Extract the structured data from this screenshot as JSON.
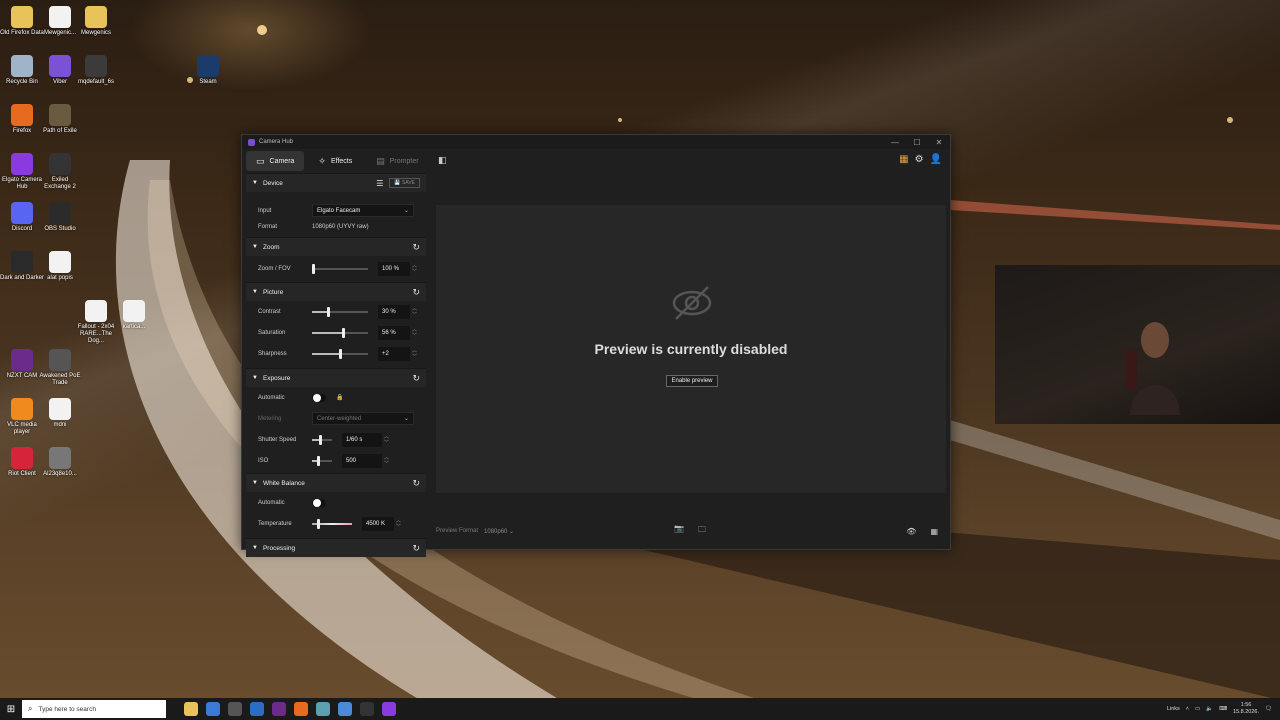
{
  "desktop": {
    "icons": [
      {
        "label": "Old Firefox Data",
        "color": "#e8c35a"
      },
      {
        "label": "Mewgenic...",
        "color": "#f2f2f2"
      },
      {
        "label": "Mewgenics",
        "color": "#e8c35a"
      },
      {
        "label": "Recycle Bin",
        "color": "#9fb4c8"
      },
      {
        "label": "Viber",
        "color": "#7b52d6"
      },
      {
        "label": "mqdefault_6s",
        "color": "#3b3b3b"
      },
      {
        "label": "Steam",
        "color": "#1b3b6b"
      },
      {
        "label": "Firefox",
        "color": "#e86a1e"
      },
      {
        "label": "Path of Exile",
        "color": "#6a5a40"
      },
      {
        "label": "Elgato Camera Hub",
        "color": "#8a3be0"
      },
      {
        "label": "Exiled Exchange 2",
        "color": "#333333"
      },
      {
        "label": "Discord",
        "color": "#5865f2"
      },
      {
        "label": "OBS Studio",
        "color": "#2b2b2b"
      },
      {
        "label": "Dark and Darker",
        "color": "#2a2a2a"
      },
      {
        "label": "alat popis",
        "color": "#f2f2f2"
      },
      {
        "label": "Fallout - 2x04 RARE...The Dog...",
        "color": "#f2f2f2"
      },
      {
        "label": "kartica...",
        "color": "#f2f2f2"
      },
      {
        "label": "NZXT CAM",
        "color": "#6b2b8b"
      },
      {
        "label": "Awakened PoE Trade",
        "color": "#555555"
      },
      {
        "label": "VLC media player",
        "color": "#f08a1e"
      },
      {
        "label": "mdni",
        "color": "#f2f2f2"
      },
      {
        "label": "Riot Client",
        "color": "#d6253a"
      },
      {
        "label": "Al23q8e10...",
        "color": "#777777"
      }
    ]
  },
  "window": {
    "title": "Camera Hub",
    "controls": [
      "—",
      "☐",
      "✕"
    ],
    "tabs": [
      {
        "label": "Camera",
        "active": true,
        "icon": "camera-icon"
      },
      {
        "label": "Effects",
        "active": false,
        "icon": "magic-wand-icon"
      },
      {
        "label": "Prompter",
        "active": false,
        "dim": true,
        "icon": "prompter-icon"
      }
    ],
    "sections": {
      "device": {
        "title": "Device",
        "save_label": "SAVE",
        "input_label": "Input",
        "input_value": "Elgato Facecam",
        "format_label": "Format",
        "format_value": "1080p60 (UYVY raw)"
      },
      "zoom": {
        "title": "Zoom",
        "zoom_label": "Zoom / FOV",
        "zoom_value": "100 %",
        "zoom_level": 0.0
      },
      "picture": {
        "title": "Picture",
        "contrast_label": "Contrast",
        "contrast_value": "30 %",
        "contrast_level": 0.3,
        "saturation_label": "Saturation",
        "saturation_value": "56 %",
        "saturation_level": 0.56,
        "sharpness_label": "Sharpness",
        "sharpness_value": "+2",
        "sharpness_level": 0.5
      },
      "exposure": {
        "title": "Exposure",
        "automatic_label": "Automatic",
        "metering_label": "Metering",
        "metering_value": "Center-weighted",
        "shutter_label": "Shutter Speed",
        "shutter_value": "1/60 s",
        "shutter_level": 0.4,
        "iso_label": "ISO",
        "iso_value": "500",
        "iso_level": 0.3
      },
      "white_balance": {
        "title": "White Balance",
        "automatic_label": "Automatic",
        "temperature_label": "Temperature",
        "temperature_value": "4500 K",
        "temperature_level": 0.15
      },
      "processing": {
        "title": "Processing"
      }
    },
    "preview": {
      "message": "Preview is currently disabled",
      "enable_label": "Enable preview",
      "format_label": "Preview Format",
      "format_value": "1080p60"
    }
  },
  "taskbar": {
    "search_placeholder": "Type here to search",
    "tray_label": "Links",
    "time": "1:56",
    "date": "15.8.2026."
  }
}
